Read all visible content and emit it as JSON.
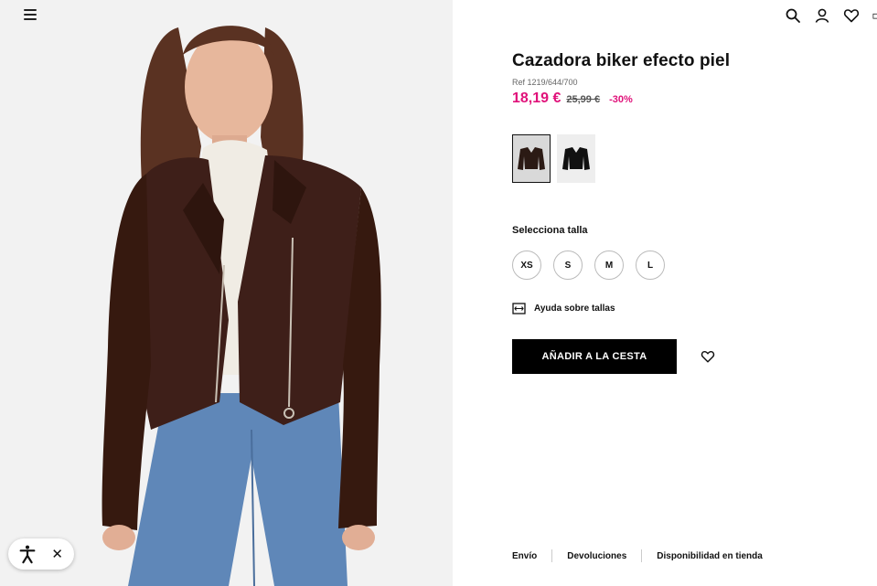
{
  "header": {
    "menu_icon": "hamburger-menu-icon",
    "icons": [
      "search-icon",
      "user-icon",
      "heart-icon",
      "bag-icon"
    ]
  },
  "product": {
    "title": "Cazadora biker efecto piel",
    "ref": "Ref 1219/644/700",
    "price_now": "18,19 €",
    "price_old": "25,99 €",
    "discount": "-30%",
    "accent_color": "#e0127a"
  },
  "colors": {
    "swatches": [
      "marrón",
      "negro"
    ],
    "selected_index": 0
  },
  "sizes": {
    "label": "Selecciona talla",
    "options": [
      "XS",
      "S",
      "M",
      "L"
    ]
  },
  "help": {
    "label": "Ayuda sobre tallas"
  },
  "cart": {
    "add_label": "AÑADIR A LA CESTA"
  },
  "footer": {
    "links": [
      "Envío",
      "Devoluciones",
      "Disponibilidad en tienda"
    ]
  },
  "accessibility": {
    "close_label": "✕"
  }
}
